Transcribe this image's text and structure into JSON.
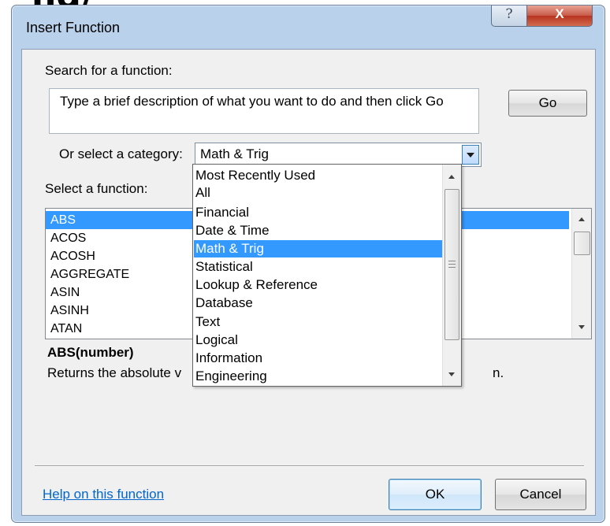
{
  "background": {
    "partial_text": "ng/"
  },
  "window": {
    "title": "Insert Function",
    "help_glyph": "?",
    "close_glyph": "X"
  },
  "search": {
    "label": "Search for a function:",
    "text": "Type a brief description of what you want to do and then click Go",
    "go_label": "Go"
  },
  "category": {
    "label": "Or select a category:",
    "selected": "Math & Trig",
    "options": [
      "Most Recently Used",
      "All",
      "Financial",
      "Date & Time",
      "Math & Trig",
      "Statistical",
      "Lookup & Reference",
      "Database",
      "Text",
      "Logical",
      "Information",
      "Engineering"
    ]
  },
  "functions": {
    "label": "Select a function:",
    "items": [
      "ABS",
      "ACOS",
      "ACOSH",
      "AGGREGATE",
      "ASIN",
      "ASINH",
      "ATAN"
    ],
    "selected": "ABS",
    "signature": "ABS(number)",
    "description_start": "Returns the absolute v",
    "description_end": "n."
  },
  "footer": {
    "help_link": "Help on this function",
    "ok_label": "OK",
    "cancel_label": "Cancel"
  },
  "colors": {
    "selection": "#3399ff",
    "link": "#0066cc",
    "frame": "#b9d1ea",
    "close_button": "#c75a48"
  }
}
